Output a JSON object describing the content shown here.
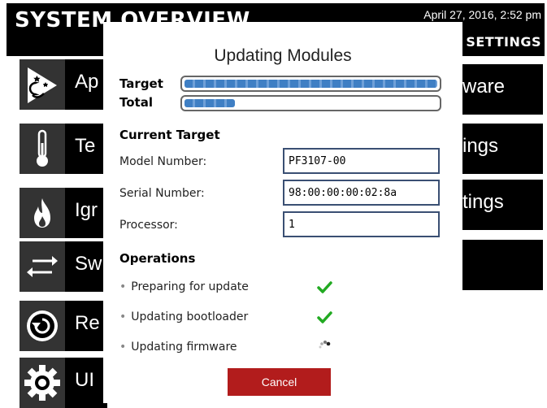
{
  "header": {
    "title": "SYSTEM OVERVIEW",
    "datetime": "April 27, 2016, 2:52 pm",
    "settings_label": "SETTINGS"
  },
  "menu": [
    {
      "label": "Ap",
      "icon": "wizard-icon"
    },
    {
      "label": "Te",
      "icon": "thermometer-icon"
    },
    {
      "label": "Igr",
      "icon": "flame-icon"
    },
    {
      "label": "Sw",
      "icon": "swap-arrows-icon"
    },
    {
      "label": "Re",
      "icon": "restore-icon"
    },
    {
      "label": "UI",
      "icon": "gear-icon"
    }
  ],
  "right_menu": [
    {
      "label": "ware"
    },
    {
      "label": "ings"
    },
    {
      "label": "tings"
    },
    {
      "label": ""
    }
  ],
  "dialog": {
    "title": "Updating Modules",
    "target_label": "Target",
    "total_label": "Total",
    "target_progress": 1.0,
    "total_progress": 0.2,
    "current_target_heading": "Current Target",
    "fields": [
      {
        "label": "Model Number:",
        "value": "PF3107-00"
      },
      {
        "label": "Serial Number:",
        "value": "98:00:00:00:02:8a"
      },
      {
        "label": "Processor:",
        "value": "1"
      }
    ],
    "operations_heading": "Operations",
    "operations": [
      {
        "label": "Preparing for update",
        "status": "done"
      },
      {
        "label": "Updating bootloader",
        "status": "done"
      },
      {
        "label": "Updating firmware",
        "status": "in-progress"
      }
    ],
    "cancel_label": "Cancel"
  },
  "colors": {
    "accent_red": "#b21c1c",
    "progress_blue": "#3f7fc4",
    "check_green": "#22aa22"
  }
}
